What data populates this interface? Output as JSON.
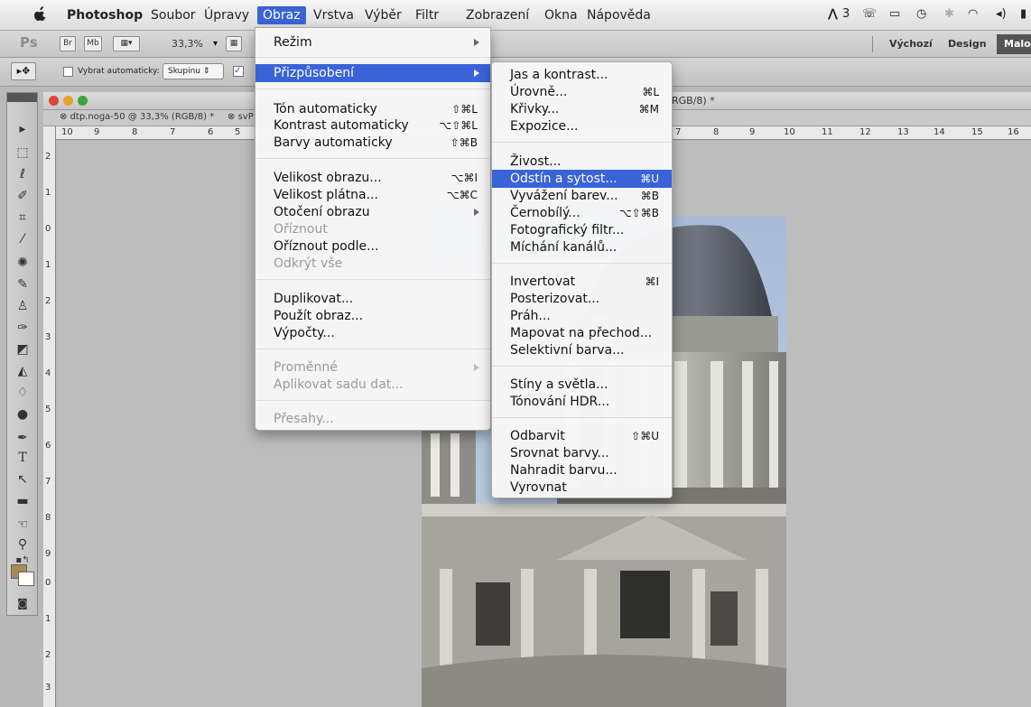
{
  "menubar": {
    "items": [
      "Photoshop",
      "Soubor",
      "Úpravy",
      "Obraz",
      "Vrstva",
      "Výběr",
      "Filtr",
      "Zobrazení",
      "Okna",
      "Nápověda"
    ],
    "status": "3"
  },
  "appbar": {
    "br": "Br",
    "mb": "Mb",
    "zoom": "33,3%",
    "workspaces": [
      "Výchozí",
      "Design",
      "Malo"
    ]
  },
  "options": {
    "auto_select_label": "Vybrat automaticky:",
    "auto_select_value": "Skupinu"
  },
  "document": {
    "tab1": "dtp.noga-50 @ 33,3% (RGB/8) *",
    "tab2": "svP",
    "title_suffix": "RGB/8) *",
    "ruler_h": [
      "10",
      "9",
      "8",
      "7",
      "6",
      "5",
      "7",
      "8",
      "9",
      "10",
      "11",
      "12",
      "13",
      "14",
      "15",
      "16"
    ],
    "ruler_v": [
      "2",
      "1",
      "0",
      "1",
      "2",
      "3",
      "4",
      "5",
      "6",
      "7",
      "8",
      "9",
      "0",
      "1",
      "2",
      "3"
    ]
  },
  "obraz_menu": {
    "items": [
      {
        "label": "Režim",
        "shortcut": "",
        "submenu": true,
        "disabled": false
      },
      {
        "label": "Přizpůsobení",
        "shortcut": "",
        "submenu": true,
        "disabled": false,
        "highlighted": true
      },
      {
        "label": "Tón automaticky",
        "shortcut": "⇧⌘L"
      },
      {
        "label": "Kontrast automaticky",
        "shortcut": "⌥⇧⌘L"
      },
      {
        "label": "Barvy automaticky",
        "shortcut": "⇧⌘B"
      },
      {
        "label": "Velikost obrazu...",
        "shortcut": "⌥⌘I"
      },
      {
        "label": "Velikost plátna...",
        "shortcut": "⌥⌘C"
      },
      {
        "label": "Otočení obrazu",
        "shortcut": "",
        "submenu": true
      },
      {
        "label": "Oříznout",
        "disabled": true
      },
      {
        "label": "Oříznout podle...",
        "shortcut": ""
      },
      {
        "label": "Odkrýt vše",
        "disabled": true
      },
      {
        "label": "Duplikovat...",
        "shortcut": ""
      },
      {
        "label": "Použít obraz...",
        "shortcut": ""
      },
      {
        "label": "Výpočty...",
        "shortcut": ""
      },
      {
        "label": "Proměnné",
        "disabled": true,
        "submenu": true
      },
      {
        "label": "Aplikovat sadu dat...",
        "disabled": true
      },
      {
        "label": "Přesahy...",
        "disabled": true
      }
    ]
  },
  "adjust_menu": {
    "items": [
      {
        "label": "Jas a kontrast...",
        "shortcut": ""
      },
      {
        "label": "Úrovně...",
        "shortcut": "⌘L"
      },
      {
        "label": "Křivky...",
        "shortcut": "⌘M"
      },
      {
        "label": "Expozice...",
        "shortcut": ""
      },
      {
        "label": "Živost...",
        "shortcut": ""
      },
      {
        "label": "Odstín a sytost...",
        "shortcut": "⌘U",
        "highlighted": true
      },
      {
        "label": "Vyvážení barev...",
        "shortcut": "⌘B"
      },
      {
        "label": "Černobílý...",
        "shortcut": "⌥⇧⌘B"
      },
      {
        "label": "Fotografický filtr...",
        "shortcut": ""
      },
      {
        "label": "Míchání kanálů...",
        "shortcut": ""
      },
      {
        "label": "Invertovat",
        "shortcut": "⌘I"
      },
      {
        "label": "Posterizovat...",
        "shortcut": ""
      },
      {
        "label": "Práh...",
        "shortcut": ""
      },
      {
        "label": "Mapovat na přechod...",
        "shortcut": ""
      },
      {
        "label": "Selektivní barva...",
        "shortcut": ""
      },
      {
        "label": "Stíny a světla...",
        "shortcut": ""
      },
      {
        "label": "Tónování HDR...",
        "shortcut": ""
      },
      {
        "label": "Odbarvit",
        "shortcut": "⇧⌘U"
      },
      {
        "label": "Srovnat barvy...",
        "shortcut": ""
      },
      {
        "label": "Nahradit barvu...",
        "shortcut": ""
      },
      {
        "label": "Vyrovnat",
        "shortcut": ""
      }
    ]
  },
  "colors": {
    "highlight": "#3a63d8",
    "foreground_swatch": "#a78a56",
    "background_swatch": "#ffffff"
  }
}
